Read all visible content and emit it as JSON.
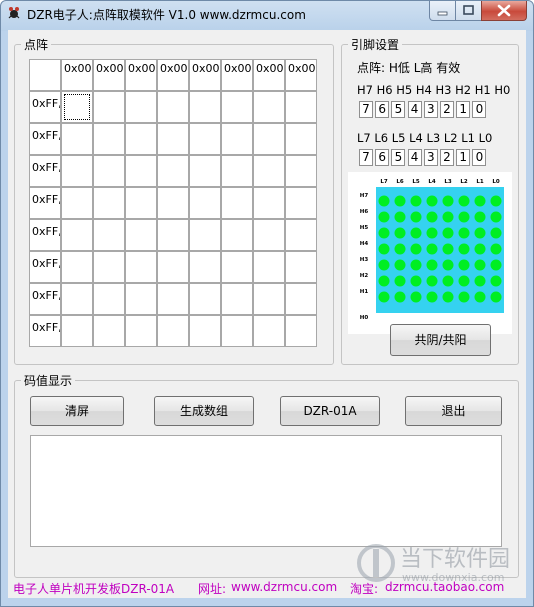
{
  "window": {
    "title": "DZR电子人:点阵取模软件 V1.0   www.dzrmcu.com"
  },
  "matrix_group": {
    "legend": "点阵",
    "col_headers": [
      "0x00,",
      "0x00,",
      "0x00,",
      "0x00,",
      "0x00,",
      "0x00,",
      "0x00,",
      "0x00,"
    ],
    "row_headers": [
      "0xFF,",
      "0xFF,",
      "0xFF,",
      "0xFF,",
      "0xFF,",
      "0xFF,",
      "0xFF,",
      "0xFF,"
    ]
  },
  "pin_group": {
    "legend": "引脚设置",
    "hint": "点阵: H低 L高 有效",
    "h_labels": "H7 H6 H5 H4 H3 H2 H1 H0",
    "h_values": [
      "7",
      "6",
      "5",
      "4",
      "3",
      "2",
      "1",
      "0"
    ],
    "l_labels": "L7 L6 L5 L4 L3 L2 L1 L0",
    "l_values": [
      "7",
      "6",
      "5",
      "4",
      "3",
      "2",
      "1",
      "0"
    ],
    "preview": {
      "col_labels": [
        "L7",
        "L6",
        "L5",
        "L4",
        "L3",
        "L2",
        "L1",
        "L0"
      ],
      "row_labels": [
        "H7",
        "H6",
        "H5",
        "H4",
        "H3",
        "H2",
        "H1",
        "H0"
      ],
      "board_color": "#35d2f0",
      "led_color": "#00ee22"
    },
    "mode_button": "共阴/共阳"
  },
  "code_group": {
    "legend": "码值显示",
    "buttons": {
      "clear": "清屏",
      "generate": "生成数组",
      "model": "DZR-01A",
      "exit": "退出"
    }
  },
  "footer": {
    "board": "电子人单片机开发板DZR-01A",
    "website_label": "网址:",
    "website": "www.dzrmcu.com",
    "taobao_label": "淘宝:",
    "taobao": "dzrmcu.taobao.com"
  },
  "watermark": {
    "name": "当下软件园",
    "url": "www.downxia.com"
  }
}
